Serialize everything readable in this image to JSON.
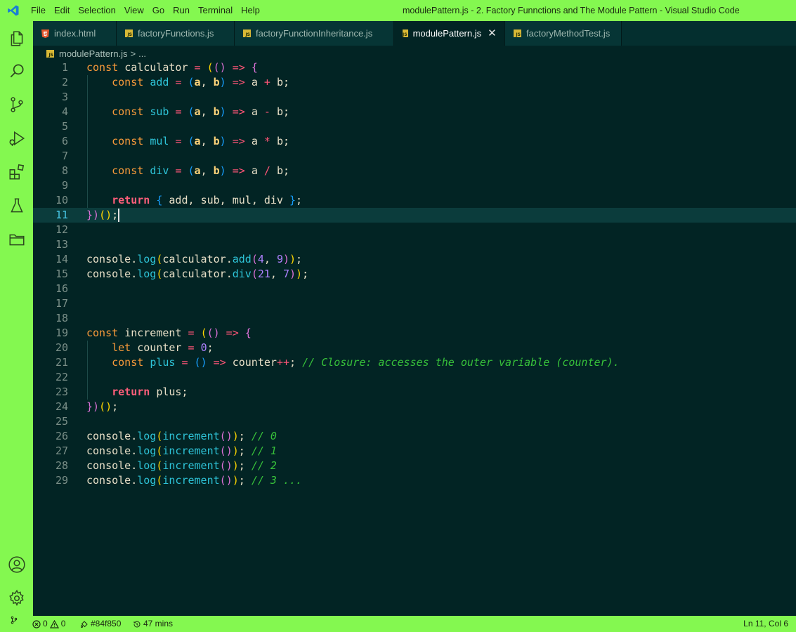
{
  "window": {
    "title": "modulePattern.js - 2. Factory Funnctions and The Module Pattern - Visual Studio Code"
  },
  "menu": [
    "File",
    "Edit",
    "Selection",
    "View",
    "Go",
    "Run",
    "Terminal",
    "Help"
  ],
  "activity_bar": {
    "top": [
      "files-icon",
      "search-icon",
      "source-control-icon",
      "run-debug-icon",
      "extensions-icon",
      "testing-icon",
      "folder-icon"
    ],
    "bottom": [
      "account-icon",
      "settings-gear-icon"
    ]
  },
  "tabs": [
    {
      "label": "index.html",
      "icon": "html-file-icon",
      "active": false
    },
    {
      "label": "factoryFunctions.js",
      "icon": "js-file-icon",
      "active": false
    },
    {
      "label": "factoryFunctionInheritance.js",
      "icon": "js-file-icon",
      "active": false
    },
    {
      "label": "modulePattern.js",
      "icon": "js-file-icon",
      "active": true,
      "close": "✕"
    },
    {
      "label": "factoryMethodTest.js",
      "icon": "js-file-icon",
      "active": false
    }
  ],
  "breadcrumb": {
    "file": "modulePattern.js",
    "separator": ">",
    "rest": "..."
  },
  "editor": {
    "current_line": 11,
    "lines": [
      {
        "n": "1",
        "tokens": [
          [
            "kw",
            "const "
          ],
          [
            "v",
            "calculator "
          ],
          [
            "op",
            "= "
          ],
          [
            "p1",
            "("
          ],
          [
            "p2",
            "("
          ],
          [
            "p2",
            ")"
          ],
          [
            "op",
            " => "
          ],
          [
            "p2",
            "{"
          ]
        ]
      },
      {
        "n": "2",
        "tokens": [
          [
            "v",
            "    "
          ],
          [
            "kw",
            "const "
          ],
          [
            "pr",
            "add "
          ],
          [
            "op",
            "= "
          ],
          [
            "p3",
            "("
          ],
          [
            "prm",
            "a"
          ],
          [
            "pn",
            ", "
          ],
          [
            "prm",
            "b"
          ],
          [
            "p3",
            ")"
          ],
          [
            "op",
            " => "
          ],
          [
            "v",
            "a "
          ],
          [
            "op",
            "+ "
          ],
          [
            "v",
            "b"
          ],
          [
            "pn",
            ";"
          ]
        ]
      },
      {
        "n": "3",
        "tokens": []
      },
      {
        "n": "4",
        "tokens": [
          [
            "v",
            "    "
          ],
          [
            "kw",
            "const "
          ],
          [
            "pr",
            "sub "
          ],
          [
            "op",
            "= "
          ],
          [
            "p3",
            "("
          ],
          [
            "prm",
            "a"
          ],
          [
            "pn",
            ", "
          ],
          [
            "prm",
            "b"
          ],
          [
            "p3",
            ")"
          ],
          [
            "op",
            " => "
          ],
          [
            "v",
            "a "
          ],
          [
            "op",
            "- "
          ],
          [
            "v",
            "b"
          ],
          [
            "pn",
            ";"
          ]
        ]
      },
      {
        "n": "5",
        "tokens": []
      },
      {
        "n": "6",
        "tokens": [
          [
            "v",
            "    "
          ],
          [
            "kw",
            "const "
          ],
          [
            "pr",
            "mul "
          ],
          [
            "op",
            "= "
          ],
          [
            "p3",
            "("
          ],
          [
            "prm",
            "a"
          ],
          [
            "pn",
            ", "
          ],
          [
            "prm",
            "b"
          ],
          [
            "p3",
            ")"
          ],
          [
            "op",
            " => "
          ],
          [
            "v",
            "a "
          ],
          [
            "op",
            "* "
          ],
          [
            "v",
            "b"
          ],
          [
            "pn",
            ";"
          ]
        ]
      },
      {
        "n": "7",
        "tokens": []
      },
      {
        "n": "8",
        "tokens": [
          [
            "v",
            "    "
          ],
          [
            "kw",
            "const "
          ],
          [
            "pr",
            "div "
          ],
          [
            "op",
            "= "
          ],
          [
            "p3",
            "("
          ],
          [
            "prm",
            "a"
          ],
          [
            "pn",
            ", "
          ],
          [
            "prm",
            "b"
          ],
          [
            "p3",
            ")"
          ],
          [
            "op",
            " => "
          ],
          [
            "v",
            "a "
          ],
          [
            "op",
            "/ "
          ],
          [
            "v",
            "b"
          ],
          [
            "pn",
            ";"
          ]
        ]
      },
      {
        "n": "9",
        "tokens": []
      },
      {
        "n": "10",
        "tokens": [
          [
            "v",
            "    "
          ],
          [
            "kw2",
            "return "
          ],
          [
            "p3",
            "{ "
          ],
          [
            "v",
            "add"
          ],
          [
            "pn",
            ", "
          ],
          [
            "v",
            "sub"
          ],
          [
            "pn",
            ", "
          ],
          [
            "v",
            "mul"
          ],
          [
            "pn",
            ", "
          ],
          [
            "v",
            "div "
          ],
          [
            "p3",
            "}"
          ],
          [
            "pn",
            ";"
          ]
        ]
      },
      {
        "n": "11",
        "tokens": [
          [
            "p2",
            "}"
          ],
          [
            "p2",
            ")"
          ],
          [
            "p1",
            "("
          ],
          [
            "p1",
            ")"
          ],
          [
            "pn",
            ";"
          ]
        ]
      },
      {
        "n": "12",
        "tokens": []
      },
      {
        "n": "13",
        "tokens": []
      },
      {
        "n": "14",
        "tokens": [
          [
            "v",
            "console"
          ],
          [
            "pn",
            "."
          ],
          [
            "pr",
            "log"
          ],
          [
            "p1",
            "("
          ],
          [
            "v",
            "calculator"
          ],
          [
            "pn",
            "."
          ],
          [
            "pr",
            "add"
          ],
          [
            "p2",
            "("
          ],
          [
            "num",
            "4"
          ],
          [
            "pn",
            ", "
          ],
          [
            "num",
            "9"
          ],
          [
            "p2",
            ")"
          ],
          [
            "p1",
            ")"
          ],
          [
            "pn",
            ";"
          ]
        ]
      },
      {
        "n": "15",
        "tokens": [
          [
            "v",
            "console"
          ],
          [
            "pn",
            "."
          ],
          [
            "pr",
            "log"
          ],
          [
            "p1",
            "("
          ],
          [
            "v",
            "calculator"
          ],
          [
            "pn",
            "."
          ],
          [
            "pr",
            "div"
          ],
          [
            "p2",
            "("
          ],
          [
            "num",
            "21"
          ],
          [
            "pn",
            ", "
          ],
          [
            "num",
            "7"
          ],
          [
            "p2",
            ")"
          ],
          [
            "p1",
            ")"
          ],
          [
            "pn",
            ";"
          ]
        ]
      },
      {
        "n": "16",
        "tokens": []
      },
      {
        "n": "17",
        "tokens": []
      },
      {
        "n": "18",
        "tokens": []
      },
      {
        "n": "19",
        "tokens": [
          [
            "kw",
            "const "
          ],
          [
            "v",
            "increment "
          ],
          [
            "op",
            "= "
          ],
          [
            "p1",
            "("
          ],
          [
            "p2",
            "("
          ],
          [
            "p2",
            ")"
          ],
          [
            "op",
            " => "
          ],
          [
            "p2",
            "{"
          ]
        ]
      },
      {
        "n": "20",
        "tokens": [
          [
            "v",
            "    "
          ],
          [
            "kw",
            "let "
          ],
          [
            "v",
            "counter "
          ],
          [
            "op",
            "= "
          ],
          [
            "num",
            "0"
          ],
          [
            "pn",
            ";"
          ]
        ]
      },
      {
        "n": "21",
        "tokens": [
          [
            "v",
            "    "
          ],
          [
            "kw",
            "const "
          ],
          [
            "pr",
            "plus "
          ],
          [
            "op",
            "= "
          ],
          [
            "p3",
            "("
          ],
          [
            "p3",
            ")"
          ],
          [
            "op",
            " => "
          ],
          [
            "v",
            "counter"
          ],
          [
            "op",
            "++"
          ],
          [
            "pn",
            "; "
          ],
          [
            "cm",
            "// Closure: accesses the outer variable (counter)."
          ]
        ]
      },
      {
        "n": "22",
        "tokens": []
      },
      {
        "n": "23",
        "tokens": [
          [
            "v",
            "    "
          ],
          [
            "kw2",
            "return "
          ],
          [
            "v",
            "plus"
          ],
          [
            "pn",
            ";"
          ]
        ]
      },
      {
        "n": "24",
        "tokens": [
          [
            "p2",
            "}"
          ],
          [
            "p2",
            ")"
          ],
          [
            "p1",
            "("
          ],
          [
            "p1",
            ")"
          ],
          [
            "pn",
            ";"
          ]
        ]
      },
      {
        "n": "25",
        "tokens": []
      },
      {
        "n": "26",
        "tokens": [
          [
            "v",
            "console"
          ],
          [
            "pn",
            "."
          ],
          [
            "pr",
            "log"
          ],
          [
            "p1",
            "("
          ],
          [
            "pr",
            "increment"
          ],
          [
            "p2",
            "("
          ],
          [
            "p2",
            ")"
          ],
          [
            "p1",
            ")"
          ],
          [
            "pn",
            "; "
          ],
          [
            "cm",
            "// 0"
          ]
        ]
      },
      {
        "n": "27",
        "tokens": [
          [
            "v",
            "console"
          ],
          [
            "pn",
            "."
          ],
          [
            "pr",
            "log"
          ],
          [
            "p1",
            "("
          ],
          [
            "pr",
            "increment"
          ],
          [
            "p2",
            "("
          ],
          [
            "p2",
            ")"
          ],
          [
            "p1",
            ")"
          ],
          [
            "pn",
            "; "
          ],
          [
            "cm",
            "// 1"
          ]
        ]
      },
      {
        "n": "28",
        "tokens": [
          [
            "v",
            "console"
          ],
          [
            "pn",
            "."
          ],
          [
            "pr",
            "log"
          ],
          [
            "p1",
            "("
          ],
          [
            "pr",
            "increment"
          ],
          [
            "p2",
            "("
          ],
          [
            "p2",
            ")"
          ],
          [
            "p1",
            ")"
          ],
          [
            "pn",
            "; "
          ],
          [
            "cm",
            "// 2"
          ]
        ]
      },
      {
        "n": "29",
        "tokens": [
          [
            "v",
            "console"
          ],
          [
            "pn",
            "."
          ],
          [
            "pr",
            "log"
          ],
          [
            "p1",
            "("
          ],
          [
            "pr",
            "increment"
          ],
          [
            "p2",
            "("
          ],
          [
            "p2",
            ")"
          ],
          [
            "p1",
            ")"
          ],
          [
            "pn",
            "; "
          ],
          [
            "cm",
            "// 3 ..."
          ]
        ]
      }
    ]
  },
  "status_bar": {
    "errors": "0",
    "warnings": "0",
    "commit": "#84f850",
    "time": "47 mins",
    "position": "Ln 11, Col 6"
  },
  "colors": {
    "accent_green": "#84f850",
    "editor_background": "#022424"
  }
}
